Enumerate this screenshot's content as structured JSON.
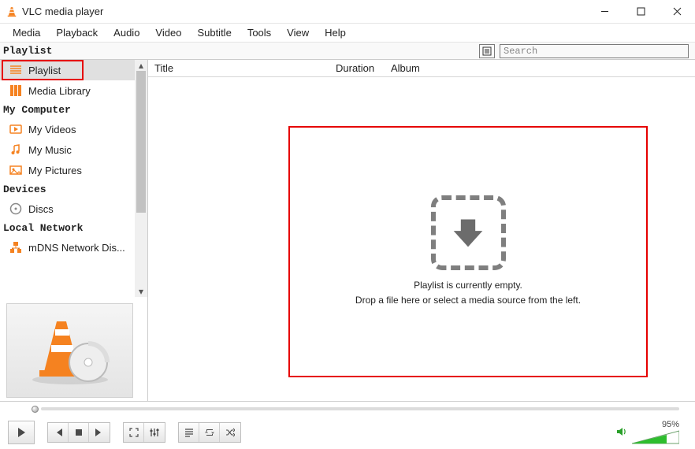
{
  "window": {
    "title": "VLC media player"
  },
  "menubar": [
    "Media",
    "Playback",
    "Audio",
    "Video",
    "Subtitle",
    "Tools",
    "View",
    "Help"
  ],
  "panel_header": {
    "title": "Playlist",
    "search_placeholder": "Search"
  },
  "sidebar": {
    "groups": [
      {
        "title": null,
        "items": [
          {
            "icon": "playlist-icon",
            "label": "Playlist",
            "selected": true
          },
          {
            "icon": "media-library-icon",
            "label": "Media Library"
          }
        ]
      },
      {
        "title": "My Computer",
        "items": [
          {
            "icon": "videos-icon",
            "label": "My Videos"
          },
          {
            "icon": "music-icon",
            "label": "My Music"
          },
          {
            "icon": "pictures-icon",
            "label": "My Pictures"
          }
        ]
      },
      {
        "title": "Devices",
        "items": [
          {
            "icon": "disc-icon",
            "label": "Discs"
          }
        ]
      },
      {
        "title": "Local Network",
        "items": [
          {
            "icon": "mdns-icon",
            "label": "mDNS Network Dis..."
          }
        ]
      }
    ]
  },
  "playlist": {
    "columns": {
      "title": "Title",
      "duration": "Duration",
      "album": "Album"
    },
    "empty_state": {
      "line1": "Playlist is currently empty.",
      "line2": "Drop a file here or select a media source from the left."
    }
  },
  "volume": {
    "percent_label": "95%"
  }
}
